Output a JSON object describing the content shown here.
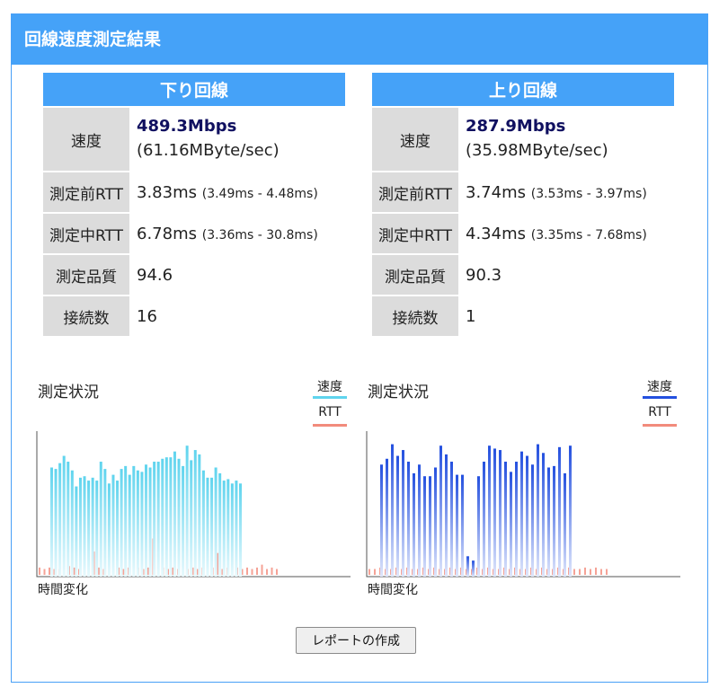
{
  "header": {
    "title": "回線速度測定結果"
  },
  "download": {
    "heading": "下り回線",
    "speed_label": "速度",
    "speed_value": "489.3Mbps",
    "speed_bytes": "(61.16MByte/sec)",
    "rtt_before_label": "測定前RTT",
    "rtt_before_value": "3.83ms",
    "rtt_before_range": "(3.49ms - 4.48ms)",
    "rtt_during_label": "測定中RTT",
    "rtt_during_value": "6.78ms",
    "rtt_during_range": "(3.36ms - 30.8ms)",
    "quality_label": "測定品質",
    "quality_value": "94.6",
    "connections_label": "接続数",
    "connections_value": "16"
  },
  "upload": {
    "heading": "上り回線",
    "speed_label": "速度",
    "speed_value": "287.9Mbps",
    "speed_bytes": "(35.98MByte/sec)",
    "rtt_before_label": "測定前RTT",
    "rtt_before_value": "3.74ms",
    "rtt_before_range": "(3.53ms - 3.97ms)",
    "rtt_during_label": "測定中RTT",
    "rtt_during_value": "4.34ms",
    "rtt_during_range": "(3.35ms - 7.68ms)",
    "quality_label": "測定品質",
    "quality_value": "90.3",
    "connections_label": "接続数",
    "connections_value": "1"
  },
  "charts": {
    "status_title": "測定状況",
    "legend_speed": "速度",
    "legend_rtt": "RTT",
    "x_caption": "時間変化"
  },
  "chart_data": [
    {
      "type": "bar",
      "series": [
        {
          "name": "速度",
          "color": "#5fd4ee",
          "values": [
            0.75,
            0.74,
            0.78,
            0.83,
            0.79,
            0.73,
            0.62,
            0.68,
            0.69,
            0.66,
            0.68,
            0.66,
            0.79,
            0.74,
            0.64,
            0.7,
            0.66,
            0.74,
            0.76,
            0.7,
            0.76,
            0.73,
            0.72,
            0.77,
            0.75,
            0.79,
            0.79,
            0.81,
            0.82,
            0.82,
            0.86,
            0.81,
            0.76,
            0.9,
            0.8,
            0.87,
            0.84,
            0.73,
            0.68,
            0.68,
            0.75,
            0.71,
            0.66,
            0.67,
            0.64,
            0.66,
            0.64
          ]
        },
        {
          "name": "RTT",
          "color": "#f28b7c",
          "values": [
            0.05,
            0.04,
            0.05,
            0.04,
            0.04,
            0.05,
            0.06,
            0.05,
            0.04,
            0.05,
            0.04,
            0.16,
            0.05,
            0.04,
            0.05,
            0.04,
            0.05,
            0.04,
            0.05,
            0.04,
            0.05,
            0.04,
            0.05,
            0.25,
            0.04,
            0.05,
            0.04,
            0.05,
            0.04,
            0.05,
            0.04,
            0.05,
            0.04,
            0.05,
            0.04,
            0.05,
            0.15,
            0.04,
            0.05,
            0.04,
            0.05,
            0.04,
            0.05,
            0.04,
            0.05,
            0.07,
            0.04,
            0.05,
            0.04
          ]
        }
      ]
    },
    {
      "type": "bar",
      "series": [
        {
          "name": "速度",
          "color": "#2450df",
          "values": [
            0.77,
            0.81,
            0.91,
            0.83,
            0.87,
            0.79,
            0.71,
            0.77,
            0.69,
            0.69,
            0.75,
            0.9,
            0.84,
            0.79,
            0.7,
            0.7,
            0.14,
            0.11,
            0.69,
            0.79,
            0.9,
            0.88,
            0.87,
            0.79,
            0.72,
            0.79,
            0.86,
            0.83,
            0.77,
            0.91,
            0.85,
            0.75,
            0.76,
            0.89,
            0.71,
            0.9
          ]
        },
        {
          "name": "RTT",
          "color": "#f28b7c",
          "values": [
            0.04,
            0.04,
            0.05,
            0.04,
            0.04,
            0.05,
            0.04,
            0.05,
            0.04,
            0.04,
            0.05,
            0.04,
            0.05,
            0.04,
            0.04,
            0.05,
            0.04,
            0.05,
            0.04,
            0.04,
            0.05,
            0.04,
            0.05,
            0.04,
            0.04,
            0.05,
            0.04,
            0.05,
            0.04,
            0.04,
            0.05,
            0.04,
            0.05,
            0.04,
            0.04,
            0.05,
            0.04,
            0.05,
            0.04,
            0.04,
            0.05,
            0.04,
            0.05,
            0.04,
            0.04
          ]
        }
      ]
    }
  ]
}
